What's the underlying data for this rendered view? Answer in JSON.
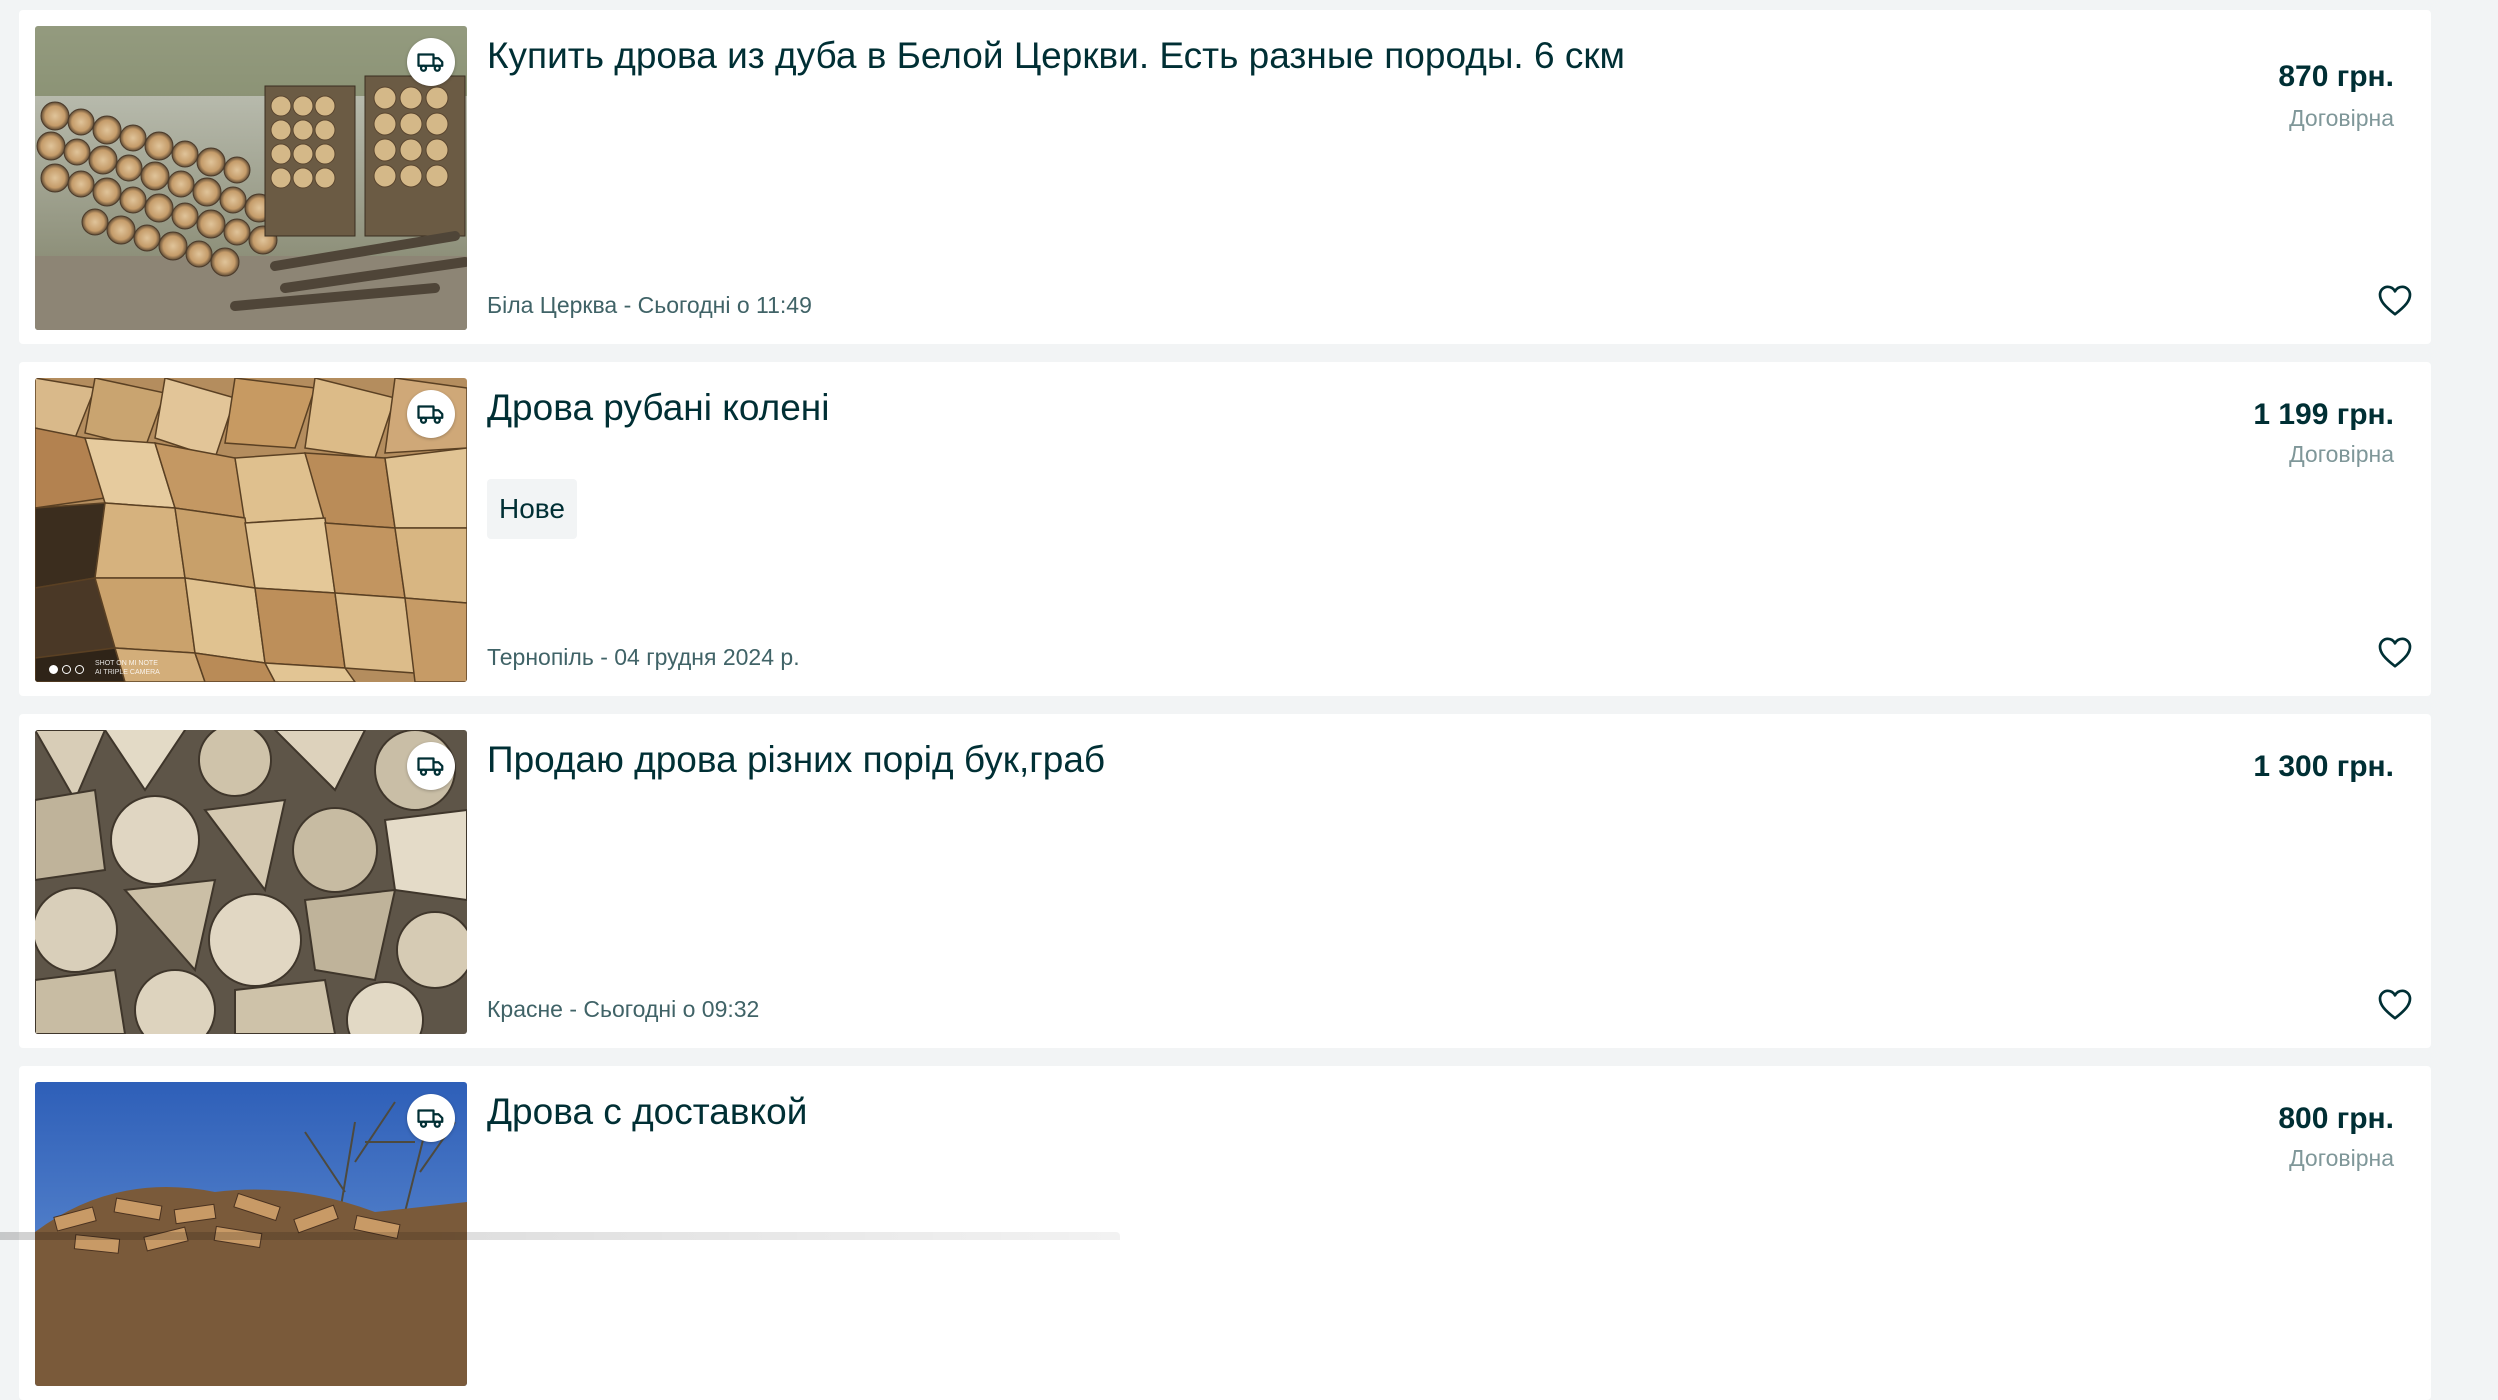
{
  "listings": [
    {
      "title": "Купить дрова из дуба в Белой Церкви. Есть разные породы. 6 скм",
      "price": "870 грн.",
      "negotiable": "Договірна",
      "location_date": "Біла Церква - Сьогодні о 11:49",
      "condition": null,
      "photo_icon": "delivery-truck-icon"
    },
    {
      "title": "Дрова рубані колені",
      "price": "1 199 грн.",
      "negotiable": "Договірна",
      "location_date": "Тернопіль - 04 грудня 2024 р.",
      "condition": "Нове",
      "photo_icon": "delivery-truck-icon"
    },
    {
      "title": "Продаю дрова різних порід бук,граб",
      "price": "1 300 грн.",
      "negotiable": null,
      "location_date": "Красне - Сьогодні о 09:32",
      "condition": null,
      "photo_icon": "delivery-truck-icon"
    },
    {
      "title": "Дрова с доставкой",
      "price": "800 грн.",
      "negotiable": "Договірна",
      "location_date": null,
      "condition": null,
      "photo_icon": "delivery-truck-icon"
    }
  ],
  "colors": {
    "page_background": "#f2f4f5",
    "card_background": "#ffffff",
    "text_primary": "#002f34",
    "text_secondary": "#406367",
    "text_muted": "#7f9799"
  }
}
